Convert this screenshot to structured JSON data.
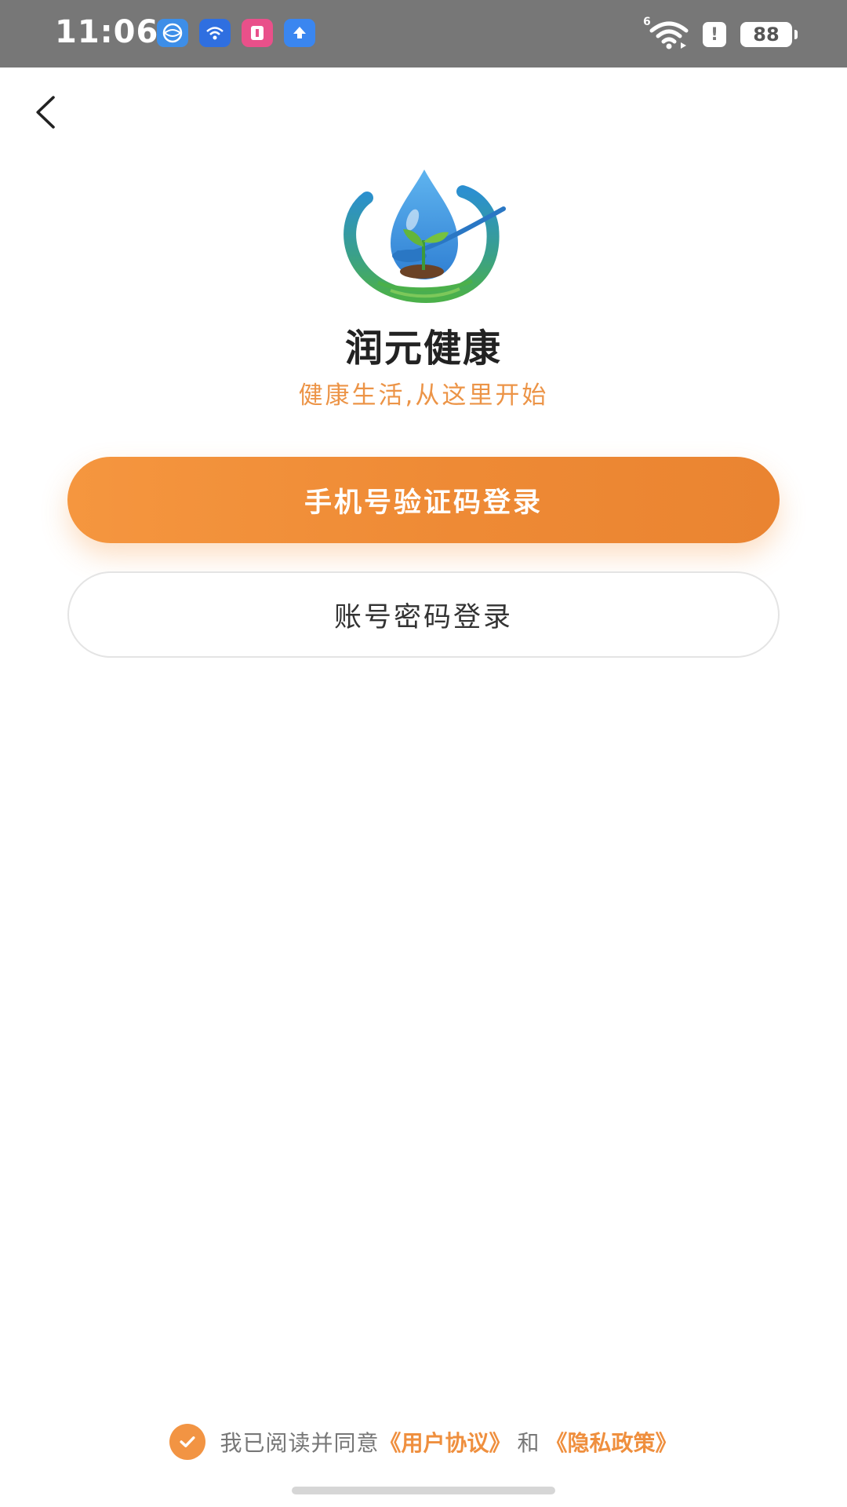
{
  "status_bar": {
    "time": "11:06",
    "network_label": "6",
    "battery": "88",
    "alert": "!",
    "icons": [
      "globe-app-icon",
      "wifi-app-icon",
      "pink-app-icon",
      "upload-app-icon"
    ]
  },
  "app": {
    "name": "润元健康",
    "slogan": "健康生活,从这里开始"
  },
  "buttons": {
    "sms_login": "手机号验证码登录",
    "password_login": "账号密码登录"
  },
  "agreement": {
    "prefix": "我已阅读并同意",
    "user_agreement": "《用户协议》",
    "and": "和",
    "privacy_policy": "《隐私政策》",
    "checked": true
  },
  "colors": {
    "accent": "#f29443",
    "status_bar": "#777777"
  }
}
